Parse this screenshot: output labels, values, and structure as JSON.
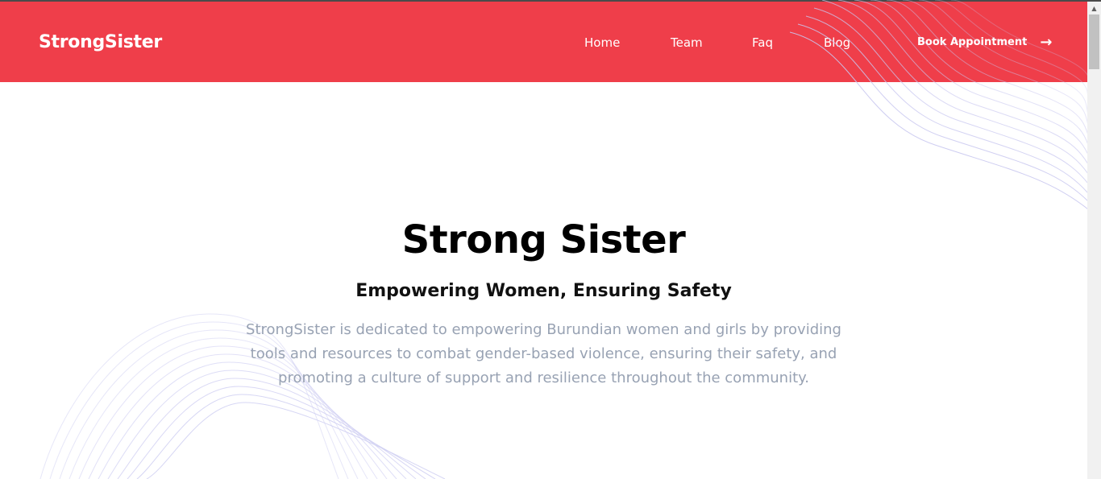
{
  "header": {
    "brand": "StrongSister",
    "nav": {
      "home": "Home",
      "team": "Team",
      "faq": "Faq",
      "blog": "Blog"
    },
    "cta_label": "Book Appointment",
    "cta_icon": "arrow-right-icon"
  },
  "hero": {
    "title": "Strong Sister",
    "subtitle": "Empowering Women, Ensuring Safety",
    "description": "StrongSister is dedicated to empowering Burundian women and girls by providing tools and resources to combat gender-based violence, ensuring their safety, and promoting a culture of support and resilience throughout the community."
  },
  "colors": {
    "header_bg": "#ef3e4a",
    "text_primary": "#000000",
    "text_muted": "#98a2b3",
    "wave_lines": "#c9c8f0"
  }
}
